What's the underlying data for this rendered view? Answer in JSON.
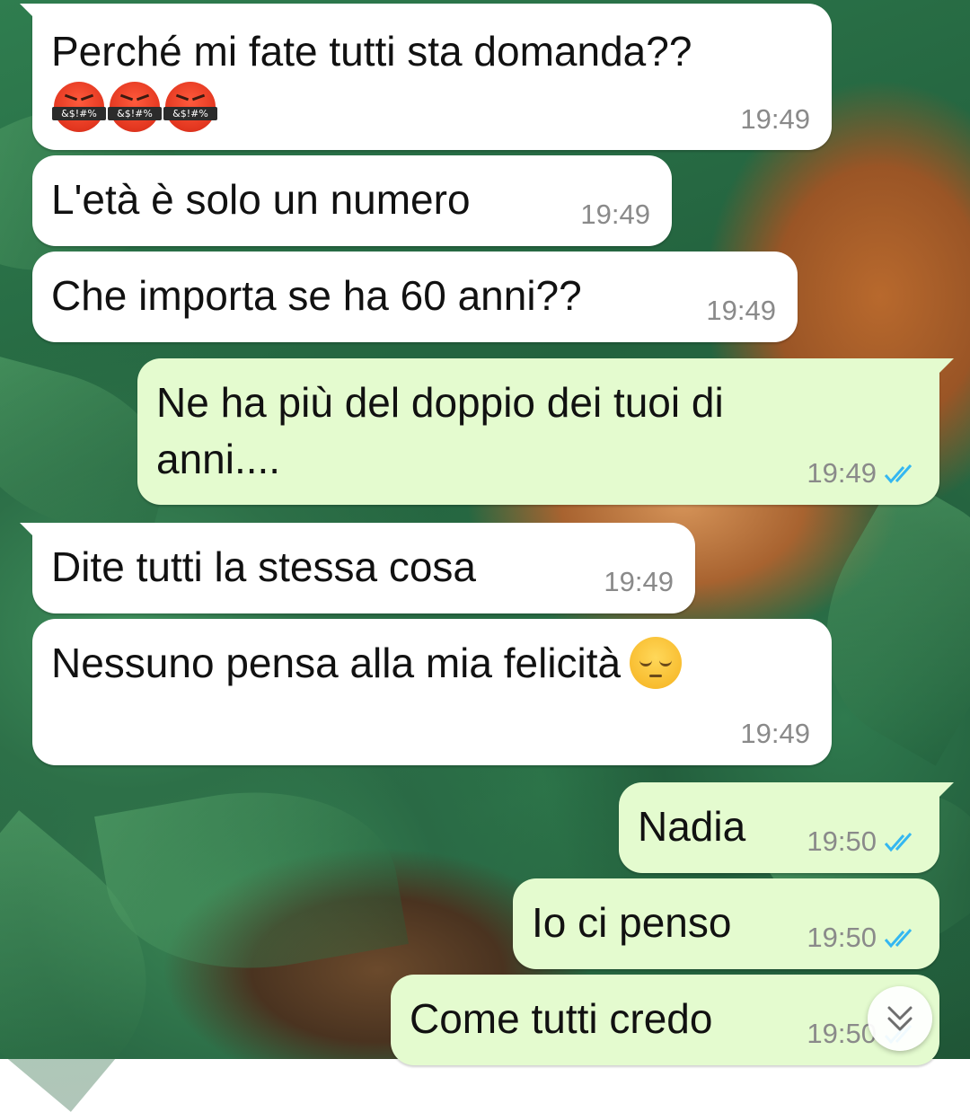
{
  "chat": {
    "messages": [
      {
        "direction": "incoming",
        "text": "Perché mi fate tutti sta domanda??",
        "emoji": [
          "angry-face-symbols",
          "angry-face-symbols",
          "angry-face-symbols"
        ],
        "emoji_label": "&$!#%",
        "time": "19:49"
      },
      {
        "direction": "incoming",
        "text": "L'età è solo un numero",
        "time": "19:49"
      },
      {
        "direction": "incoming",
        "text": "Che importa se ha 60 anni??",
        "time": "19:49"
      },
      {
        "direction": "outgoing",
        "text_lines": [
          "Ne ha più del doppio dei tuoi di",
          "anni...."
        ],
        "time": "19:49",
        "status": "read"
      },
      {
        "direction": "incoming",
        "text": "Dite tutti la stessa cosa",
        "time": "19:49"
      },
      {
        "direction": "incoming",
        "text": "Nessuno pensa alla mia felicità",
        "emoji": [
          "pensive-face"
        ],
        "time": "19:49"
      },
      {
        "direction": "outgoing",
        "text": "Nadia",
        "time": "19:50",
        "status": "read"
      },
      {
        "direction": "outgoing",
        "text": "Io ci penso",
        "time": "19:50",
        "status": "read"
      },
      {
        "direction": "outgoing",
        "text": "Come tutti credo",
        "time": "19:50",
        "status": "read"
      }
    ],
    "scroll_button_icon": "double-chevron-down-icon"
  },
  "colors": {
    "incoming_bubble": "#ffffff",
    "outgoing_bubble": "#e4fbcf",
    "read_ticks": "#34b7f1",
    "timestamp": "#8a8a8a"
  }
}
